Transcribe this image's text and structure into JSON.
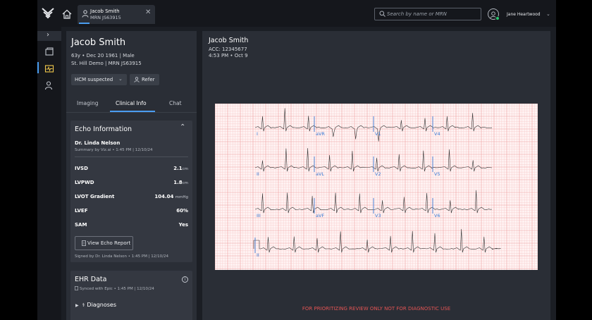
{
  "app": {
    "tab": {
      "patient_name": "Jacob Smith",
      "mrn": "MRN JS63915"
    },
    "search": {
      "placeholder": "Search by name or MRN"
    },
    "user": {
      "name": "Jane Heartwood"
    },
    "icons": [
      "logo-icon",
      "home-icon",
      "user-icon",
      "close-icon",
      "search-icon",
      "avatar-icon",
      "chevron-down-icon",
      "chevron-right-icon",
      "folder-icon",
      "heart-monitor-icon",
      "person-icon"
    ]
  },
  "patient": {
    "name": "Jacob Smith",
    "demographics": "63y • Dec 20 1961 | Male",
    "site": "St. Hill Demo | MRN JS63915",
    "status_dropdown": "HCM suspected",
    "refer_label": "Refer",
    "tabs": [
      {
        "label": "Imaging"
      },
      {
        "label": "Clinical Info"
      },
      {
        "label": "Chat"
      }
    ],
    "active_tab": "Clinical Info"
  },
  "echo": {
    "title": "Echo Information",
    "doctor": "Dr. Linda Nelson",
    "summary": "Summary by Viz.ai • 1:45 PM | 12/10/24",
    "measurements": [
      {
        "label": "IVSD",
        "value": "2.1",
        "unit": "cm"
      },
      {
        "label": "LVPWD",
        "value": "1.8",
        "unit": "cm"
      },
      {
        "label": "LVOT Gradient",
        "value": "104.04",
        "unit": "mmHg"
      },
      {
        "label": "LVEF",
        "value": "60%",
        "unit": ""
      },
      {
        "label": "SAM",
        "value": "Yes",
        "unit": ""
      }
    ],
    "view_report_label": "View Echo Report",
    "signed": "Signed by Dr. Linda Nelson • 1:45 PM | 12/10/24"
  },
  "ehr": {
    "title": "EHR Data",
    "synced": "Synced with Epic • 1:45 PM | 12/10/24",
    "section": "Diagnoses"
  },
  "ecg_view": {
    "patient_name": "Jacob Smith",
    "acc": "ACC: 12345677",
    "time": "4:53 PM • Oct 9",
    "leads": [
      [
        "I",
        "aVR",
        "V1",
        "V4"
      ],
      [
        "II",
        "aVL",
        "V2",
        "V5"
      ],
      [
        "III",
        "aVF",
        "V3",
        "V6"
      ],
      [
        "II"
      ]
    ],
    "footer": "FOR PRIORITIZING REVIEW ONLY NOT FOR DIAGNOSTIC USE",
    "colors": {
      "grid_minor": "#f6c9c9",
      "grid_major": "#ee9f9f",
      "paper": "#fff3f3",
      "trace": "#333333",
      "marker": "#3a7bd5"
    }
  }
}
